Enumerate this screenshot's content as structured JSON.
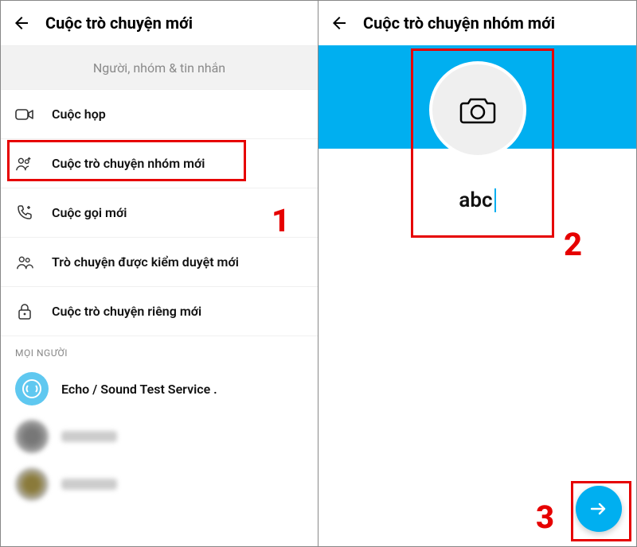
{
  "left": {
    "title": "Cuộc trò chuyện mới",
    "search_placeholder": "Người, nhóm & tin nhắn",
    "menu": {
      "meeting": "Cuộc họp",
      "new_group": "Cuộc trò chuyện nhóm mới",
      "new_call": "Cuộc gọi mới",
      "moderated_chat": "Trò chuyện được kiểm duyệt mới",
      "private_chat": "Cuộc trò chuyện riêng mới"
    },
    "section_people": "MỌI NGƯỜI",
    "contacts": {
      "echo": "Echo / Sound Test Service ."
    }
  },
  "right": {
    "title": "Cuộc trò chuyện nhóm mới",
    "group_name_value": "abc"
  },
  "steps": {
    "one": "1",
    "two": "2",
    "three": "3"
  }
}
